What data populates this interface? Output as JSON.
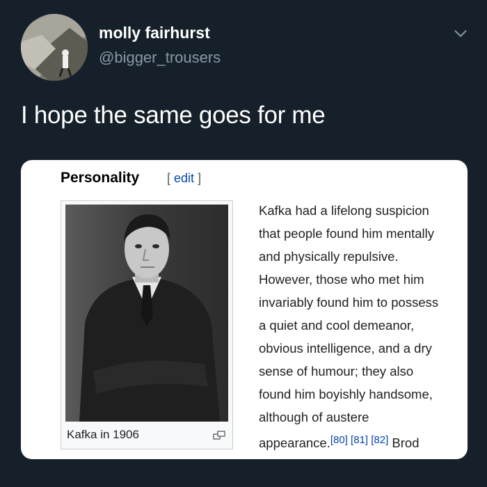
{
  "tweet": {
    "author": {
      "display_name": "molly fairhurst",
      "handle": "@bigger_trousers",
      "avatar": "profile-photo"
    },
    "menu_icon": "chevron-down-icon",
    "text": "I hope the same goes for me"
  },
  "attached_image": {
    "section_title": "Personality",
    "edit": {
      "bracket_open": "[",
      "label": "edit",
      "bracket_close": "]"
    },
    "figure": {
      "caption": "Kafka in 1906",
      "enlarge_icon": "magnify-clip-icon"
    },
    "body_lines": [
      "Kafka had a lifelong suspicion",
      "that people found him mentally",
      "and physically repulsive.",
      "However, those who met him",
      "invariably found him to possess",
      "a quiet and cool demeanor,",
      "obvious intelligence, and a dry",
      "sense of humour; they also",
      "found him boyishly handsome,",
      "although of austere"
    ],
    "last_line": {
      "text": "appearance.",
      "refs": "[80] [81] [82]",
      "trailing": "Brod"
    }
  },
  "colors": {
    "background": "#15202b",
    "secondary_text": "#8899a6",
    "link": "#0645ad"
  }
}
